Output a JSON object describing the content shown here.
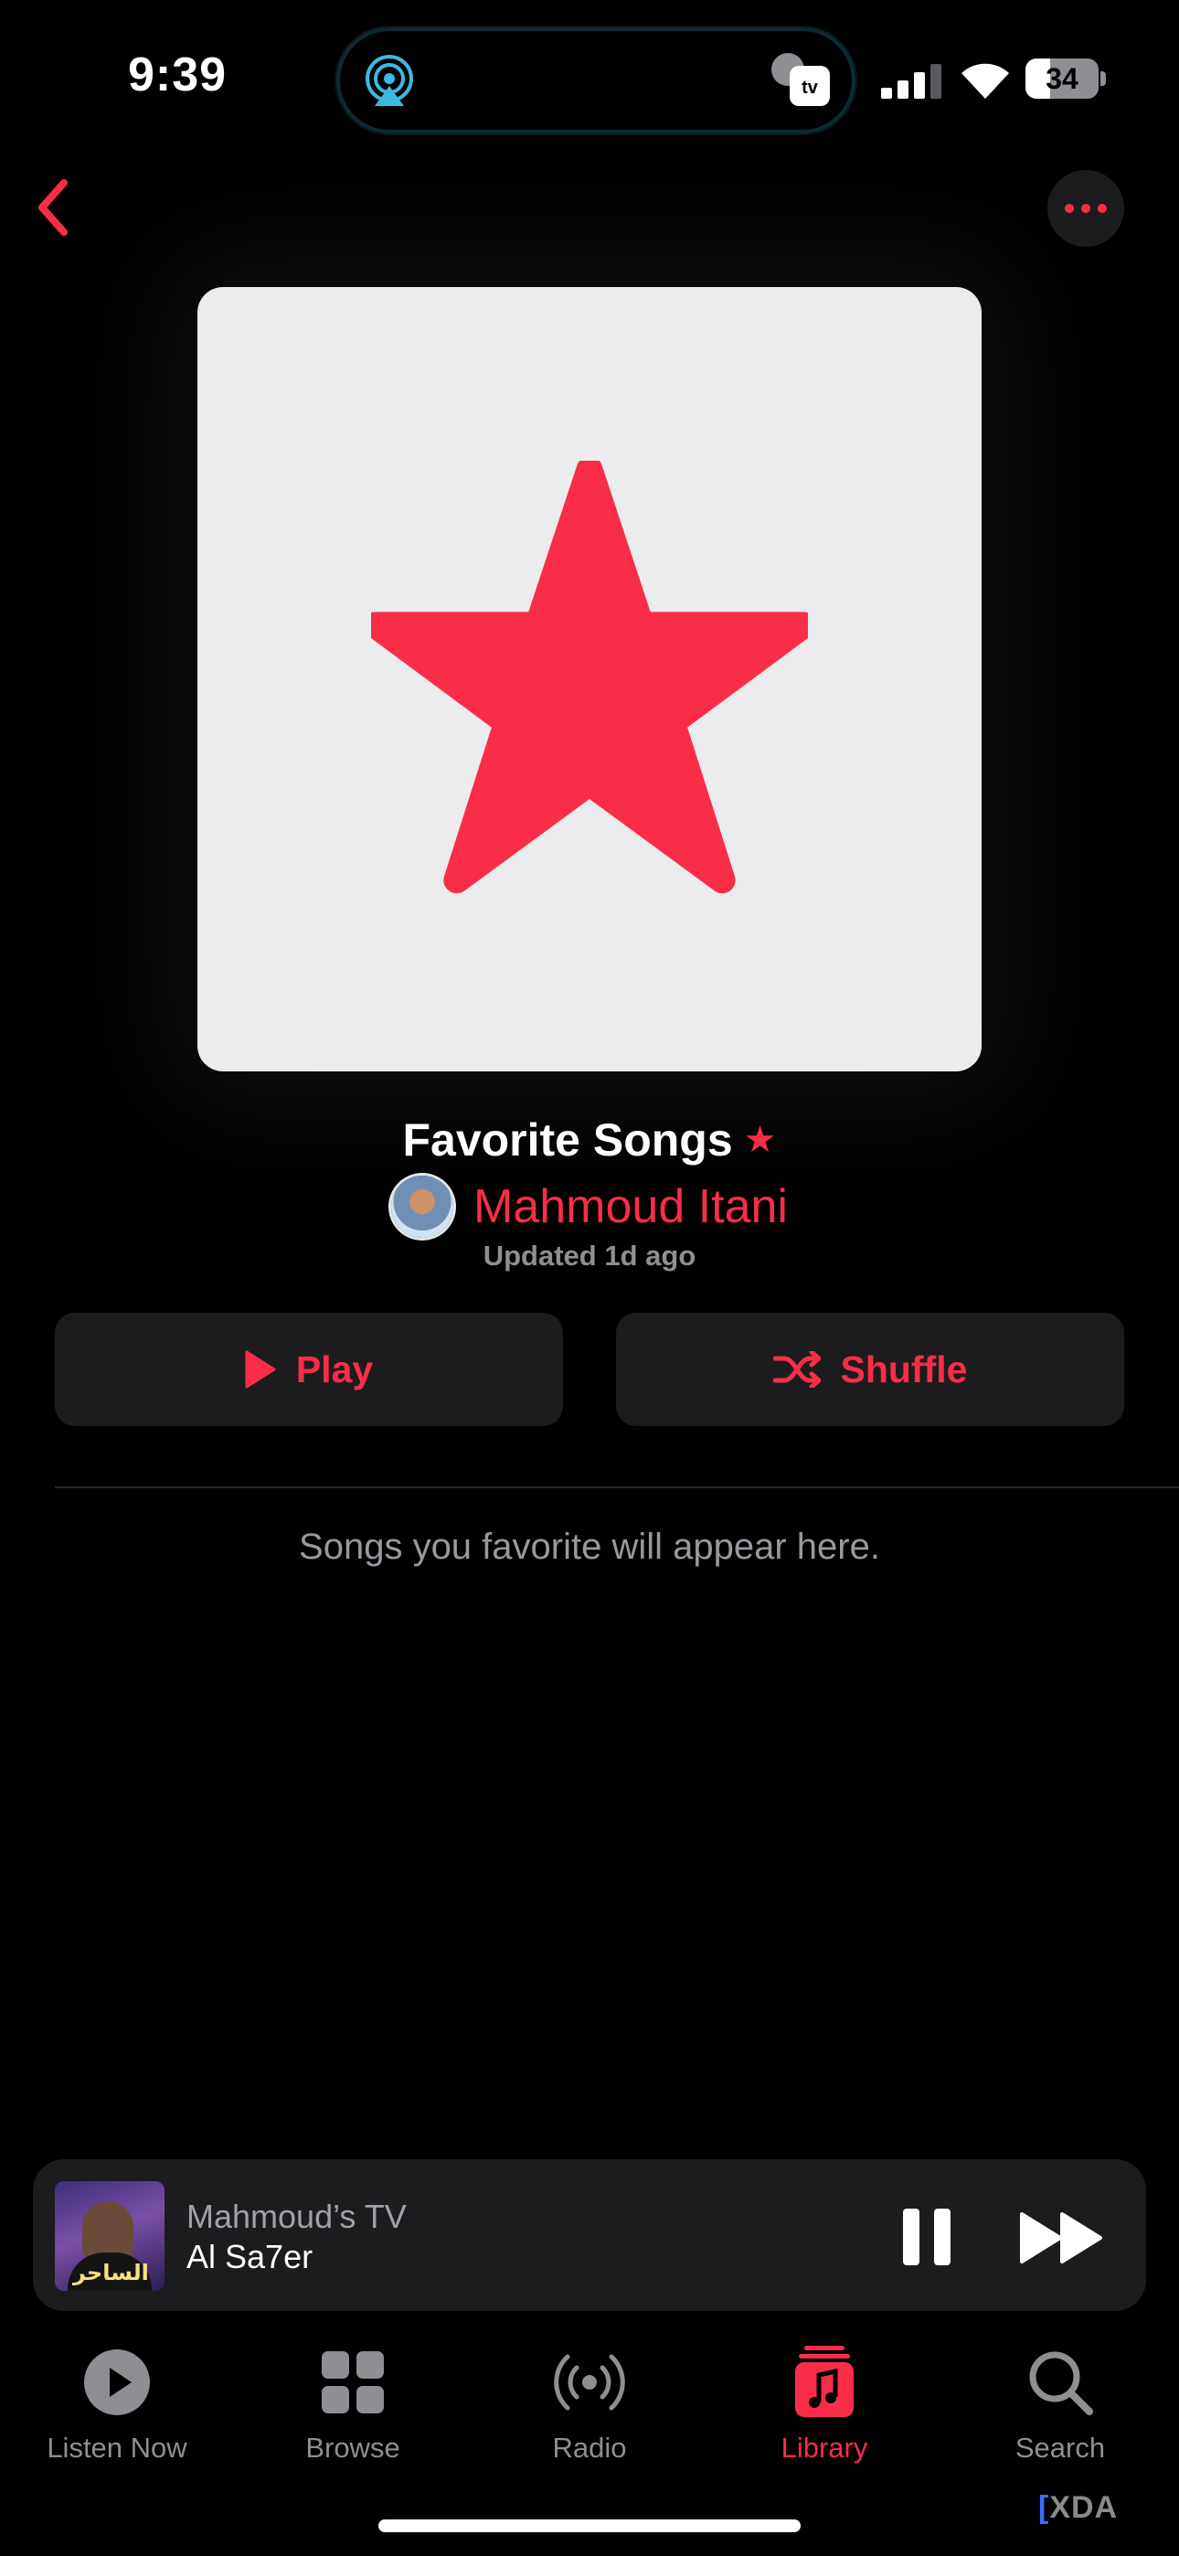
{
  "status_bar": {
    "time": "9:39",
    "battery": "34",
    "icons": [
      "airplay-icon",
      "apple-tv-icon",
      "cellular-signal-icon",
      "wifi-icon",
      "battery-icon"
    ]
  },
  "nav": {
    "back_icon": "chevron-left-icon",
    "more_icon": "ellipsis-icon"
  },
  "playlist": {
    "title": "Favorite Songs",
    "title_badge": "★",
    "curator": "Mahmoud Itani",
    "updated": "Updated 1d ago",
    "artwork_icon": "star-icon"
  },
  "actions": {
    "play": "Play",
    "shuffle": "Shuffle"
  },
  "empty_message": "Songs you favorite will appear here.",
  "mini_player": {
    "source": "Mahmoud’s TV",
    "track": "Al Sa7er",
    "art_text": "الساحر"
  },
  "tabs": [
    {
      "label": "Listen Now",
      "icon": "play-circle-icon",
      "active": false
    },
    {
      "label": "Browse",
      "icon": "grid-icon",
      "active": false
    },
    {
      "label": "Radio",
      "icon": "radio-waves-icon",
      "active": false
    },
    {
      "label": "Library",
      "icon": "music-library-icon",
      "active": true
    },
    {
      "label": "Search",
      "icon": "search-icon",
      "active": false
    }
  ],
  "watermark": {
    "bracket": "[",
    "brand": "XDA"
  },
  "colors": {
    "accent": "#fa2d48",
    "background": "#000000",
    "surface": "#1c1c1e",
    "secondary_text": "#8e8e93"
  }
}
